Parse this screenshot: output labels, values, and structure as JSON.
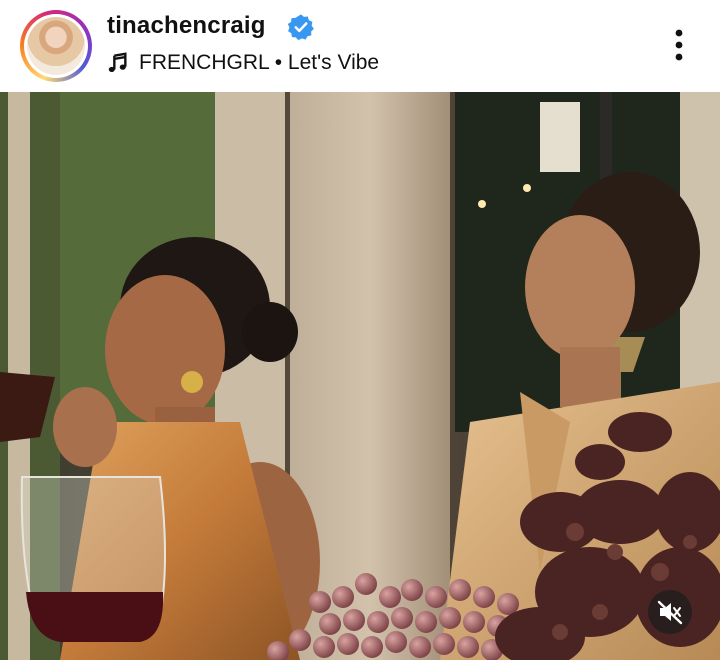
{
  "post_header": {
    "username": "tinachencraig",
    "verified": true,
    "audio_artist": "FRENCHGRL",
    "audio_separator": "•",
    "audio_title": "Let's Vibe",
    "audio_label": "FRENCHGRL • Let's Vibe"
  },
  "icons": {
    "verified": "verified-badge-icon",
    "music": "music-note-icon",
    "more": "more-options-icon",
    "mute": "muted-speaker-icon"
  },
  "colors": {
    "verified_blue": "#3897f0",
    "story_ring": [
      "#feda75",
      "#fa7e1e",
      "#d62976",
      "#962fbf",
      "#4f5bd5"
    ]
  },
  "media": {
    "type": "video",
    "muted": true
  }
}
